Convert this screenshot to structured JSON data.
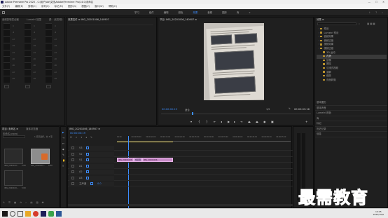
{
  "window": {
    "title": "Adobe Premiere Pro 2020 - C:\\用户\\Ad\\文档\\Adobe\\Premiere Pro\\14.0\\未命名",
    "controls": "— ☐ ✕"
  },
  "menubar": [
    "文件(F)",
    "编辑(E)",
    "剪辑(C)",
    "序列(S)",
    "标记(M)",
    "图形(G)",
    "视图(V)",
    "窗口(W)",
    "帮助(H)"
  ],
  "workspaces": {
    "tabs": [
      "学习",
      "组件",
      "编辑",
      "颜色",
      "效果",
      "音频",
      "图形",
      "库"
    ],
    "active": "效果",
    "more": "»"
  },
  "source_panel": {
    "tabs": [
      "音频剪辑混合器",
      "Lumetri 范围",
      "源：(无剪辑)"
    ],
    "scale": [
      "0",
      "-6",
      "-12",
      "-18",
      "-24",
      "-30",
      "-36",
      "-42",
      "-48",
      "dB"
    ]
  },
  "effect_controls": {
    "tab": "效果控件 ≡ IMG_20201006_140907",
    "label": "效果控件"
  },
  "program_monitor": {
    "tab": "节目: IMG_20201006_140907 ≡",
    "timecode_left": "00:00:00:19",
    "fit": "适合",
    "zoom": "1/2",
    "timecode_right": "00:00:03:16"
  },
  "effects_panel": {
    "tab": "效果 ≡",
    "tree": [
      {
        "label": "预设",
        "indent": 0
      },
      {
        "label": "Lumetri 预设",
        "indent": 0
      },
      {
        "label": "音频效果",
        "indent": 0
      },
      {
        "label": "音频过渡",
        "indent": 0
      },
      {
        "label": "视频效果",
        "indent": 0
      },
      {
        "label": "视频过渡",
        "indent": 0
      },
      {
        "label": "3D 运动",
        "indent": 1
      },
      {
        "label": "内滑",
        "indent": 1
      },
      {
        "label": "划像",
        "indent": 1
      },
      {
        "label": "擦除",
        "indent": 1
      },
      {
        "label": "沉浸式视频",
        "indent": 1
      },
      {
        "label": "溶解",
        "indent": 1
      },
      {
        "label": "缩放",
        "indent": 1
      },
      {
        "label": "页面剥落",
        "indent": 1
      }
    ],
    "selected_index": 7,
    "sections": [
      "基本图形",
      "基本声音",
      "Lumetri 颜色",
      "库",
      "标记",
      "历史记录",
      "信息"
    ]
  },
  "project_panel": {
    "tabs": [
      "项目: 未命名 ≡",
      "媒体浏览器"
    ],
    "project_file": "未命名.prproj",
    "item_count": "1 项已选择，共 3 项",
    "items": [
      {
        "name": "IMG_2020100...",
        "duration": "5:00"
      },
      {
        "name": "IMG_2020100...",
        "duration": "5:00"
      },
      {
        "name": "IMG_2020100...",
        "duration": "5:00"
      }
    ]
  },
  "timeline": {
    "tab": "IMG_20201006_140907 ≡",
    "timecode": "00:00:00:19",
    "ruler": [
      "00:00",
      "00:00:05:00",
      "00:00:10:00",
      "00:00:15:00",
      "00:00:20:00",
      "00:00:25:00",
      "00:00:30:00",
      "00:00:35:00",
      "00:00:40:00",
      "00:00:45:00",
      "00:00:50:00",
      "00:00:55:00"
    ],
    "tracks": [
      "V3",
      "V2",
      "V1",
      "A1",
      "A2",
      "A3",
      "主声道"
    ],
    "master_value": "0.0",
    "clips": [
      "IMG_20201006",
      "交叉溶",
      "IMG_20201006"
    ]
  },
  "tools": [
    "▶",
    "⇥",
    "↔",
    "◆",
    "✎",
    "✋",
    "T"
  ],
  "taskbar": {
    "time": "19:45",
    "date": "2020/10/6"
  },
  "watermark": "最需教育",
  "colors": {
    "accent": "#3c8dff",
    "clip": "#c78bc7",
    "playhead": "#3c8dff"
  }
}
